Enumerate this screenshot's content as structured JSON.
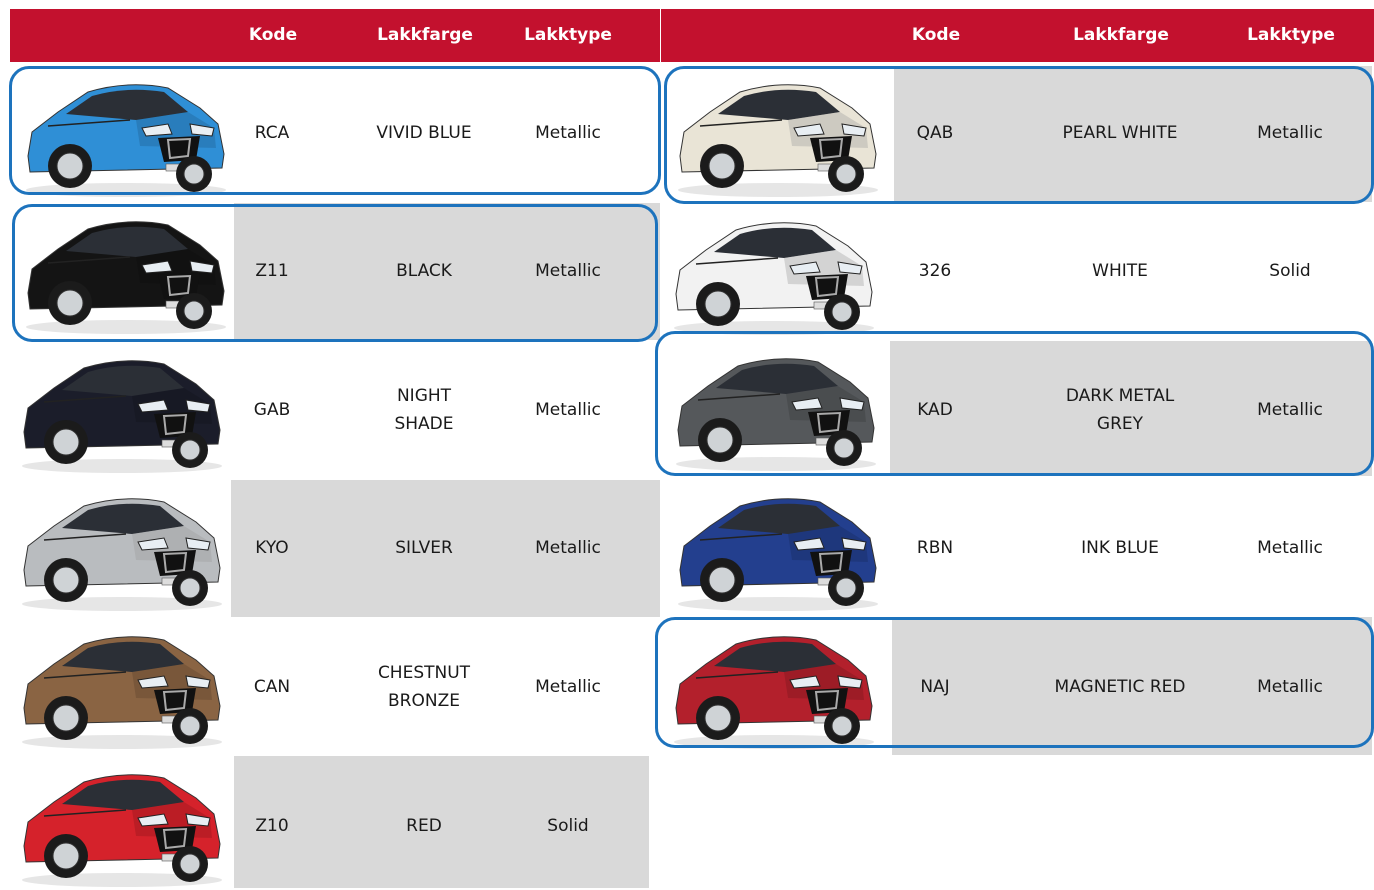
{
  "header": {
    "left": {
      "kode": "Kode",
      "lakkfarge": "Lakkfarge",
      "lakktype": "Lakktype"
    },
    "right": {
      "kode": "Kode",
      "lakkfarge": "Lakkfarge",
      "lakktype": "Lakktype"
    }
  },
  "left_rows": [
    {
      "kode": "RCA",
      "lakkfarge": "VIVID BLUE",
      "lakktype": "Metallic",
      "color": "#2f8fd6"
    },
    {
      "kode": "Z11",
      "lakkfarge": "BLACK",
      "lakktype": "Metallic",
      "color": "#141414"
    },
    {
      "kode": "GAB",
      "lakkfarge": "NIGHT\nSHADE",
      "lakktype": "Metallic",
      "color": "#1b1d2a"
    },
    {
      "kode": "KYO",
      "lakkfarge": "SILVER",
      "lakktype": "Metallic",
      "color": "#b9bcbf"
    },
    {
      "kode": "CAN",
      "lakkfarge": "CHESTNUT\nBRONZE",
      "lakktype": "Metallic",
      "color": "#8a6443"
    },
    {
      "kode": "Z10",
      "lakkfarge": "RED",
      "lakktype": "Solid",
      "color": "#d5222b"
    }
  ],
  "right_rows": [
    {
      "kode": "QAB",
      "lakkfarge": "PEARL WHITE",
      "lakktype": "Metallic",
      "color": "#e9e4d6"
    },
    {
      "kode": "326",
      "lakkfarge": "WHITE",
      "lakktype": "Solid",
      "color": "#f2f2f2"
    },
    {
      "kode": "KAD",
      "lakkfarge": "DARK METAL\nGREY",
      "lakktype": "Metallic",
      "color": "#55585b"
    },
    {
      "kode": "RBN",
      "lakkfarge": "INK BLUE",
      "lakktype": "Metallic",
      "color": "#233f8e"
    },
    {
      "kode": "NAJ",
      "lakkfarge": "MAGNETIC RED",
      "lakktype": "Metallic",
      "color": "#b3202c"
    }
  ],
  "colors": {
    "header": "#c3112e",
    "highlight": "#1d73bd",
    "row_shade": "#d9d9d9"
  }
}
